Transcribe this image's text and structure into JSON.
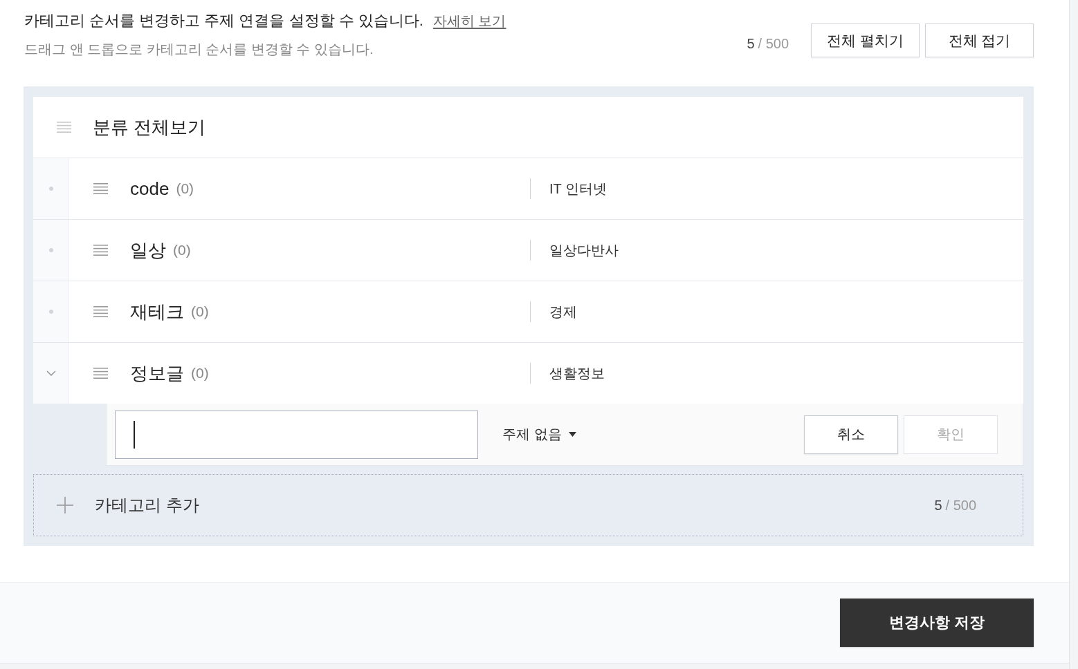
{
  "header": {
    "description": "카테고리 순서를 변경하고 주제 연결을 설정할 수 있습니다.",
    "help_link": "자세히 보기",
    "hint": "드래그 앤 드롭으로 카테고리 순서를 변경할 수 있습니다.",
    "counter": {
      "count": "5",
      "limit": "/ 500"
    },
    "buttons": [
      "전체 펼치기",
      "전체 접기"
    ]
  },
  "category_list": {
    "root": "분류 전체보기",
    "items": [
      {
        "name": "code",
        "count": "(0)",
        "topic": "IT 인터넷",
        "expanded": false
      },
      {
        "name": "일상",
        "count": "(0)",
        "topic": "일상다반사",
        "expanded": false
      },
      {
        "name": "재테크",
        "count": "(0)",
        "topic": "경제",
        "expanded": false
      },
      {
        "name": "정보글",
        "count": "(0)",
        "topic": "생활정보",
        "expanded": true
      }
    ]
  },
  "new_category_form": {
    "name_field": {
      "focused": true
    },
    "topic_dropdown": "주제 없음",
    "buttons": [
      {
        "label": "취소",
        "disabled": false
      },
      {
        "label": "확인",
        "disabled": true
      }
    ]
  },
  "add_category": {
    "label": "카테고리 추가",
    "counter": {
      "count": "5",
      "limit": "/ 500"
    }
  },
  "footer": {
    "save_button": "변경사항 저장"
  }
}
